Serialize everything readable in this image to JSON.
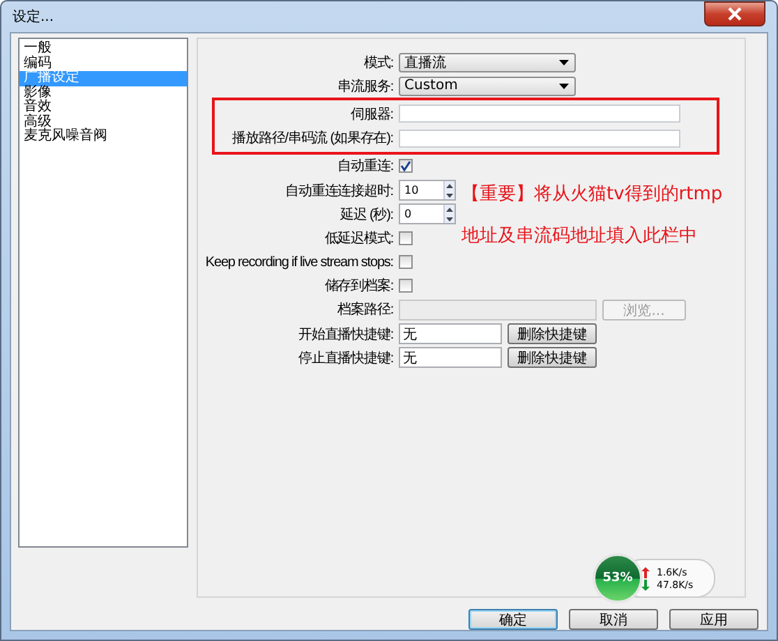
{
  "window": {
    "title": "设定..."
  },
  "sidebar": {
    "items": [
      {
        "label": "一般",
        "selected": false
      },
      {
        "label": "编码",
        "selected": false
      },
      {
        "label": "广播设定",
        "selected": true
      },
      {
        "label": "影像",
        "selected": false
      },
      {
        "label": "音效",
        "selected": false
      },
      {
        "label": "高级",
        "selected": false
      },
      {
        "label": "麦克风噪音阀",
        "selected": false
      }
    ]
  },
  "settings": [
    {
      "kind": "dropdown",
      "label": "模式:",
      "value": "直播流"
    },
    {
      "kind": "dropdown",
      "label": "串流服务:",
      "value": "Custom"
    },
    {
      "kind": "text",
      "label": "伺服器:",
      "highlighted": true
    },
    {
      "kind": "text",
      "label": "播放路径/串码流 (如果存在):",
      "highlighted": true
    },
    {
      "kind": "checkbox",
      "label": "自动重连:",
      "checked": true
    },
    {
      "kind": "spinner",
      "label": "自动重连连接超时:",
      "value": "10"
    },
    {
      "kind": "spinner",
      "label": "延迟 (秒):",
      "value": "0"
    },
    {
      "kind": "checkbox",
      "label": "低延迟模式:",
      "checked": false
    },
    {
      "kind": "checkbox",
      "label": "Keep recording if live stream stops:",
      "checked": false
    },
    {
      "kind": "checkbox",
      "label": "储存到档案:",
      "checked": false
    },
    {
      "kind": "file",
      "label": "档案路径:",
      "button": "浏览...",
      "disabled": true
    },
    {
      "kind": "hotkey",
      "label": "开始直播快捷键:",
      "value": "无",
      "button": "删除快捷键"
    },
    {
      "kind": "hotkey",
      "label": "停止直播快捷键:",
      "value": "无",
      "button": "删除快捷键"
    }
  ],
  "annotation": {
    "lines": [
      "【重要】将从火猫tv得到的rtmp",
      "地址及串流码地址填入此栏中"
    ]
  },
  "buttons": [
    "确定",
    "取消",
    "应用"
  ],
  "speed_widget": {
    "percent": "53%",
    "upload": "1.6K/s",
    "download": "47.8K/s"
  }
}
